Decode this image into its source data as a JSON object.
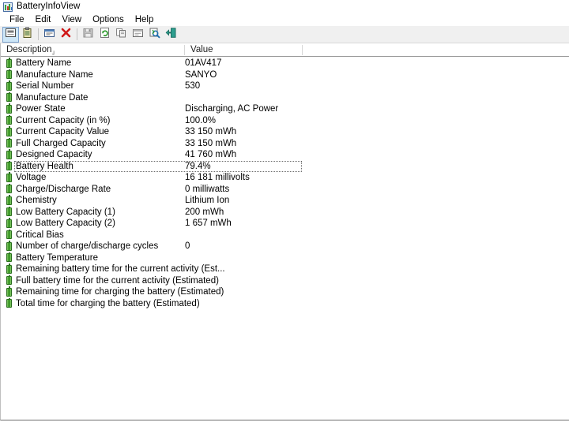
{
  "window": {
    "title": "BatteryInfoView",
    "icon": "battery-bars-icon"
  },
  "menu": {
    "items": [
      {
        "label": "File",
        "name": "menu-file"
      },
      {
        "label": "Edit",
        "name": "menu-edit"
      },
      {
        "label": "View",
        "name": "menu-view"
      },
      {
        "label": "Options",
        "name": "menu-options"
      },
      {
        "label": "Help",
        "name": "menu-help"
      }
    ]
  },
  "toolbar": {
    "buttons": [
      {
        "icon": "summary-view-icon",
        "name": "toolbar-summary-view",
        "active": true
      },
      {
        "icon": "clipboard-log-icon",
        "name": "toolbar-log-view",
        "active": false
      },
      {
        "icon": "properties-icon",
        "name": "toolbar-properties",
        "active": false
      },
      {
        "icon": "delete-red-x-icon",
        "name": "toolbar-delete",
        "active": false
      },
      {
        "icon": "save-floppy-icon",
        "name": "toolbar-save",
        "active": false
      },
      {
        "icon": "refresh-icon",
        "name": "toolbar-refresh",
        "active": false
      },
      {
        "icon": "copy-icon",
        "name": "toolbar-copy",
        "active": false
      },
      {
        "icon": "html-report-icon",
        "name": "toolbar-html-report",
        "active": false
      },
      {
        "icon": "find-icon",
        "name": "toolbar-find",
        "active": false
      },
      {
        "icon": "exit-door-icon",
        "name": "toolbar-exit",
        "active": false
      }
    ]
  },
  "list": {
    "columns": [
      {
        "label": "Description",
        "name": "column-header-description",
        "sorted": true
      },
      {
        "label": "Value",
        "name": "column-header-value",
        "sorted": false
      }
    ],
    "sort_indicator": "sort-ascending-icon",
    "rows": [
      {
        "description": "Battery Name",
        "value": "01AV417",
        "focused": false
      },
      {
        "description": "Manufacture Name",
        "value": "SANYO",
        "focused": false
      },
      {
        "description": "Serial Number",
        "value": "  530",
        "focused": false
      },
      {
        "description": "Manufacture Date",
        "value": "",
        "focused": false
      },
      {
        "description": "Power State",
        "value": "Discharging, AC Power",
        "focused": false
      },
      {
        "description": "Current Capacity (in %)",
        "value": "100.0%",
        "focused": false
      },
      {
        "description": "Current Capacity Value",
        "value": "33 150 mWh",
        "focused": false
      },
      {
        "description": "Full Charged Capacity",
        "value": "33 150 mWh",
        "focused": false
      },
      {
        "description": "Designed Capacity",
        "value": "41 760 mWh",
        "focused": false
      },
      {
        "description": "Battery Health",
        "value": "79.4%",
        "focused": true
      },
      {
        "description": "Voltage",
        "value": "16 181 millivolts",
        "focused": false
      },
      {
        "description": "Charge/Discharge Rate",
        "value": "0 milliwatts",
        "focused": false
      },
      {
        "description": "Chemistry",
        "value": "Lithium Ion",
        "focused": false
      },
      {
        "description": "Low Battery Capacity (1)",
        "value": "200 mWh",
        "focused": false
      },
      {
        "description": "Low Battery Capacity (2)",
        "value": "1 657 mWh",
        "focused": false
      },
      {
        "description": "Critical Bias",
        "value": "",
        "focused": false
      },
      {
        "description": "Number of charge/discharge cycles",
        "value": "0",
        "focused": false
      },
      {
        "description": "Battery Temperature",
        "value": "",
        "focused": false
      },
      {
        "description": "Remaining battery time for the current activity (Est...",
        "value": "",
        "focused": false
      },
      {
        "description": "Full battery time for the current activity (Estimated)",
        "value": "",
        "focused": false
      },
      {
        "description": "Remaining time for charging the battery (Estimated)",
        "value": "",
        "focused": false
      },
      {
        "description": "Total  time for charging the battery (Estimated)",
        "value": "",
        "focused": false
      }
    ]
  },
  "colors": {
    "battery_green": "#3ba23b",
    "toolbar_bg": "#f0f0f0",
    "selection_blue": "#cde6f7",
    "header_rule": "#9a9a9a"
  }
}
